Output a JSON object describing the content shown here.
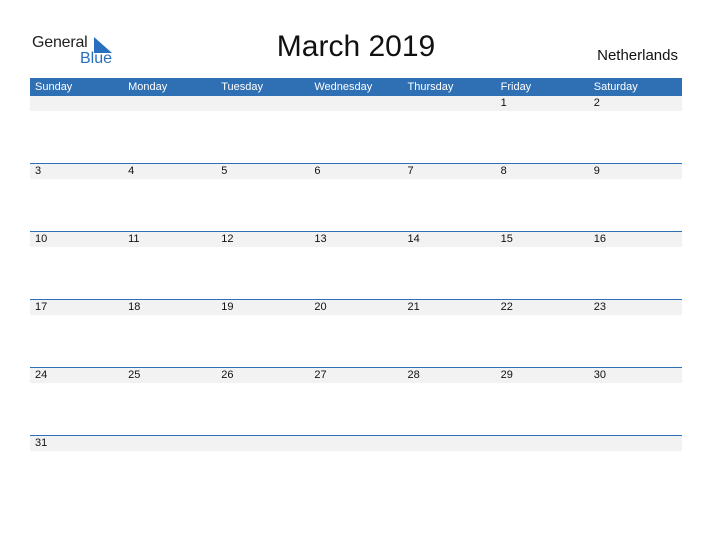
{
  "logo": {
    "general": "General",
    "blue": "Blue"
  },
  "title": "March 2019",
  "country": "Netherlands",
  "weekdays": [
    "Sunday",
    "Monday",
    "Tuesday",
    "Wednesday",
    "Thursday",
    "Friday",
    "Saturday"
  ],
  "weeks": [
    [
      "",
      "",
      "",
      "",
      "",
      "1",
      "2"
    ],
    [
      "3",
      "4",
      "5",
      "6",
      "7",
      "8",
      "9"
    ],
    [
      "10",
      "11",
      "12",
      "13",
      "14",
      "15",
      "16"
    ],
    [
      "17",
      "18",
      "19",
      "20",
      "21",
      "22",
      "23"
    ],
    [
      "24",
      "25",
      "26",
      "27",
      "28",
      "29",
      "30"
    ],
    [
      "31",
      "",
      "",
      "",
      "",
      "",
      ""
    ]
  ],
  "colors": {
    "accent": "#2f6fb3",
    "day_bar": "#f2f2f2",
    "logo_blue": "#2a6fbd"
  }
}
